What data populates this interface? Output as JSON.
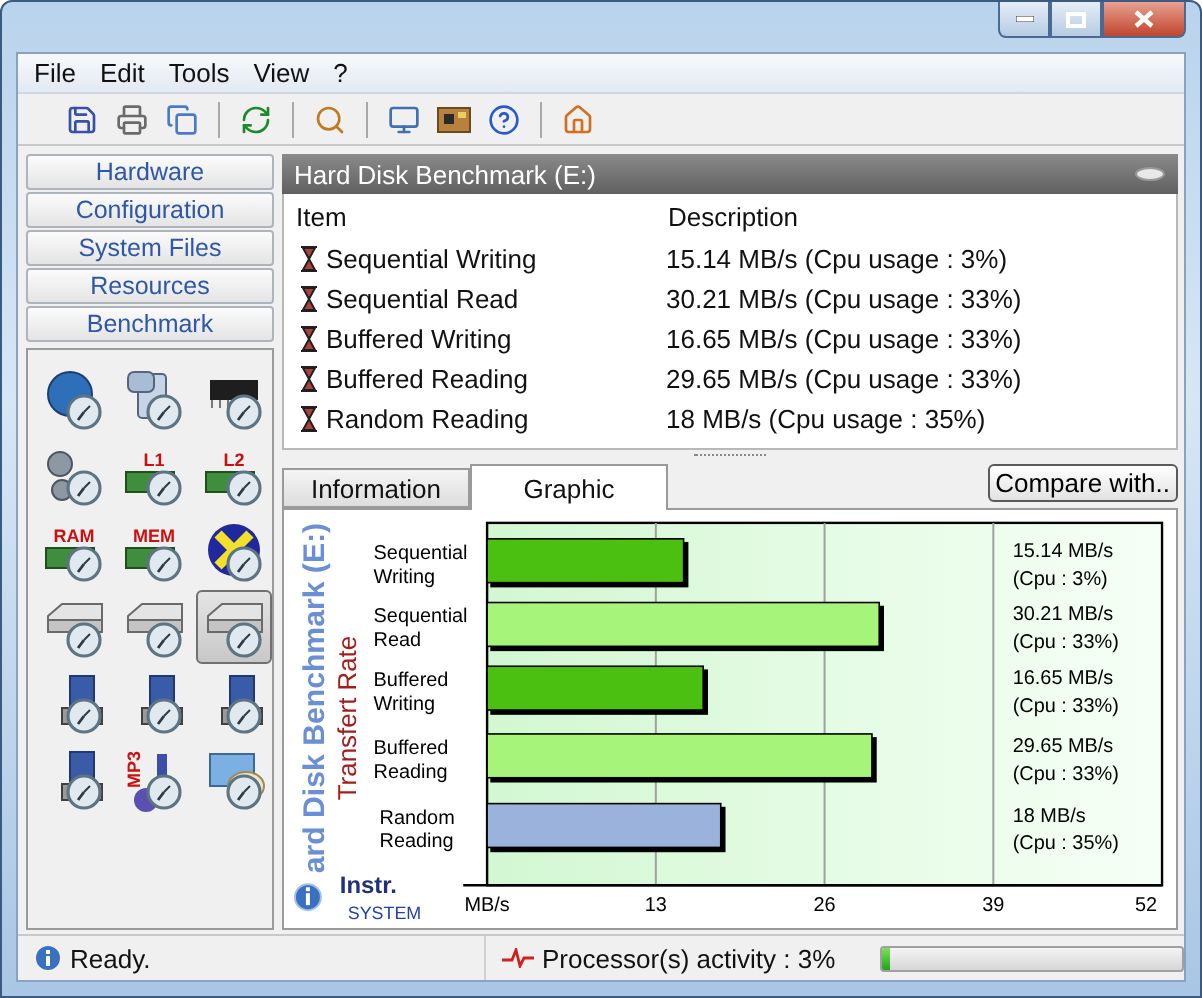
{
  "menu": [
    "File",
    "Edit",
    "Tools",
    "View",
    "?"
  ],
  "toolbar": [
    {
      "kind": "save"
    },
    {
      "kind": "print"
    },
    {
      "kind": "copy"
    },
    {
      "kind": "separator"
    },
    {
      "kind": "refresh"
    },
    {
      "kind": "separator"
    },
    {
      "kind": "search"
    },
    {
      "kind": "separator"
    },
    {
      "kind": "computer"
    },
    {
      "kind": "board"
    },
    {
      "kind": "help"
    },
    {
      "kind": "separator"
    },
    {
      "kind": "home"
    }
  ],
  "sidebar": {
    "categories": [
      "Hardware",
      "Configuration",
      "System Files",
      "Resources",
      "Benchmark"
    ],
    "benchmarks": [
      {
        "kind": "globe",
        "selected": false
      },
      {
        "kind": "computer",
        "selected": false
      },
      {
        "kind": "chip",
        "selected": false
      },
      {
        "kind": "gears",
        "selected": false
      },
      {
        "kind": "memory",
        "label": "L1",
        "selected": false
      },
      {
        "kind": "memory",
        "label": "L2",
        "selected": false
      },
      {
        "kind": "memory",
        "label": "RAM",
        "selected": false
      },
      {
        "kind": "memory",
        "label": "MEM",
        "selected": false
      },
      {
        "kind": "cross",
        "selected": false
      },
      {
        "kind": "drive",
        "selected": false
      },
      {
        "kind": "drive",
        "selected": false
      },
      {
        "kind": "drive",
        "selected": true
      },
      {
        "kind": "floppy",
        "selected": false
      },
      {
        "kind": "floppy",
        "selected": false
      },
      {
        "kind": "floppy",
        "selected": false
      },
      {
        "kind": "floppy",
        "selected": false
      },
      {
        "kind": "music",
        "label": "MP3",
        "selected": false
      },
      {
        "kind": "palette",
        "selected": false
      }
    ]
  },
  "panel": {
    "title": "Hard Disk Benchmark (E:)",
    "columns": [
      "Item",
      "Description"
    ],
    "rows": [
      {
        "item": "Sequential Writing",
        "description": "15.14 MB/s (Cpu usage : 3%)"
      },
      {
        "item": "Sequential Read",
        "description": "30.21 MB/s  (Cpu usage : 33%)"
      },
      {
        "item": "Buffered Writing",
        "description": "16.65 MB/s  (Cpu usage : 33%)"
      },
      {
        "item": "Buffered Reading",
        "description": "29.65 MB/s  (Cpu usage : 33%)"
      },
      {
        "item": "Random Reading",
        "description": "18 MB/s  (Cpu usage : 35%)"
      }
    ]
  },
  "tabs": [
    {
      "label": "Information",
      "selected": false
    },
    {
      "label": "Graphic",
      "selected": true
    }
  ],
  "compare_button": "Compare with..",
  "chart_panel": {
    "brand": [
      "Instr.",
      "SYSTEM"
    ],
    "chart_data": {
      "type": "bar",
      "orientation": "horizontal",
      "title": "ard Disk Benchmark (E:)",
      "ylabel": "Transfert Rate",
      "categories": [
        [
          "Sequential",
          "Writing"
        ],
        [
          "Sequential",
          "Read"
        ],
        [
          "Buffered",
          "Writing"
        ],
        [
          "Buffered",
          "Reading"
        ],
        [
          "Random",
          "Reading"
        ]
      ],
      "series": [
        {
          "color": "#4cc010",
          "values": [
            15.14,
            null,
            16.65,
            null,
            null
          ]
        },
        {
          "color": "#a6f57a",
          "values": [
            null,
            30.21,
            null,
            29.65,
            null
          ]
        },
        {
          "color": "#9bb3dc",
          "values": [
            null,
            null,
            null,
            null,
            18
          ]
        }
      ],
      "xlim": [
        0,
        52
      ],
      "grid": true,
      "xticks": [
        {
          "value": 0,
          "label": "MB/s"
        },
        {
          "value": 13,
          "label": "13"
        },
        {
          "value": 26,
          "label": "26"
        },
        {
          "value": 39,
          "label": "39"
        },
        {
          "value": 52,
          "label": "52"
        }
      ],
      "value_labels": [
        [
          "15.14  MB/s",
          "(Cpu : 3%)"
        ],
        [
          "30.21  MB/s",
          "(Cpu : 33%)"
        ],
        [
          "16.65  MB/s",
          "(Cpu : 33%)"
        ],
        [
          "29.65  MB/s",
          "(Cpu : 33%)"
        ],
        [
          "18 MB/s",
          "(Cpu : 35%)"
        ]
      ]
    }
  },
  "status_bar": {
    "message": "Ready.",
    "activity": "Processor(s) activity : 3%",
    "level": 0.03
  }
}
